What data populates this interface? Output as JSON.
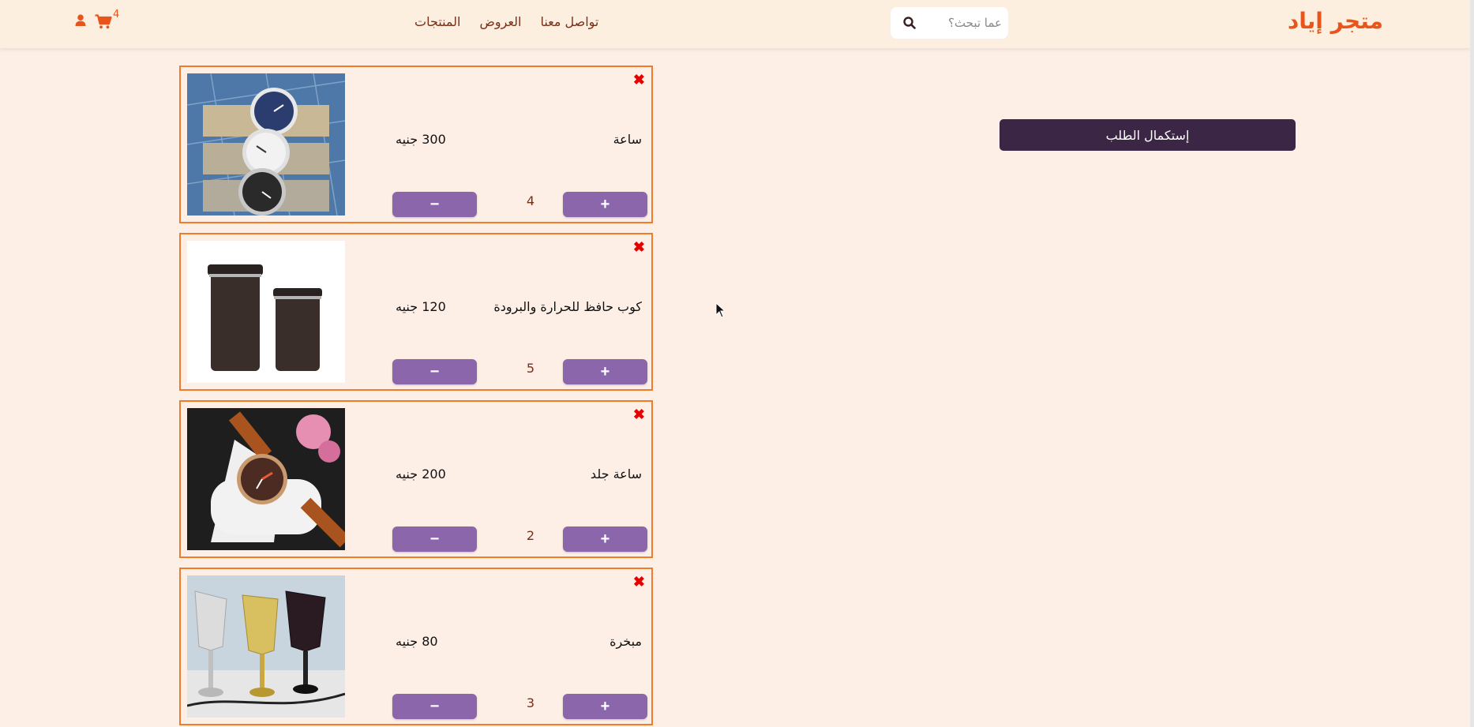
{
  "header": {
    "brand": "متجر إياد",
    "search_placeholder": "عما تبحث؟",
    "nav": [
      "المنتجات",
      "العروض",
      "تواصل معنا"
    ],
    "cart_count": "4"
  },
  "cart": {
    "items": [
      {
        "name": "ساعة",
        "price": "300 جنيه",
        "qty": "4",
        "image": "silver-watches-photo"
      },
      {
        "name": "كوب حافظ للحرارة والبرودة",
        "price": "120 جنيه",
        "qty": "5",
        "image": "thermal-cups-photo"
      },
      {
        "name": "ساعة جلد",
        "price": "200 جنيه",
        "qty": "2",
        "image": "leather-watch-photo"
      },
      {
        "name": "مبخرة",
        "price": "80 جنيه",
        "qty": "3",
        "image": "incense-burners-photo"
      }
    ],
    "remove_symbol": "✖",
    "plus_label": "+",
    "minus_label": "−",
    "checkout_label": "إستكمال الطلب"
  },
  "colors": {
    "background": "#fdeee6",
    "header": "#fdefdf",
    "accent": "#e9541a",
    "button": "#8b66ab",
    "checkout": "#3c2645"
  }
}
